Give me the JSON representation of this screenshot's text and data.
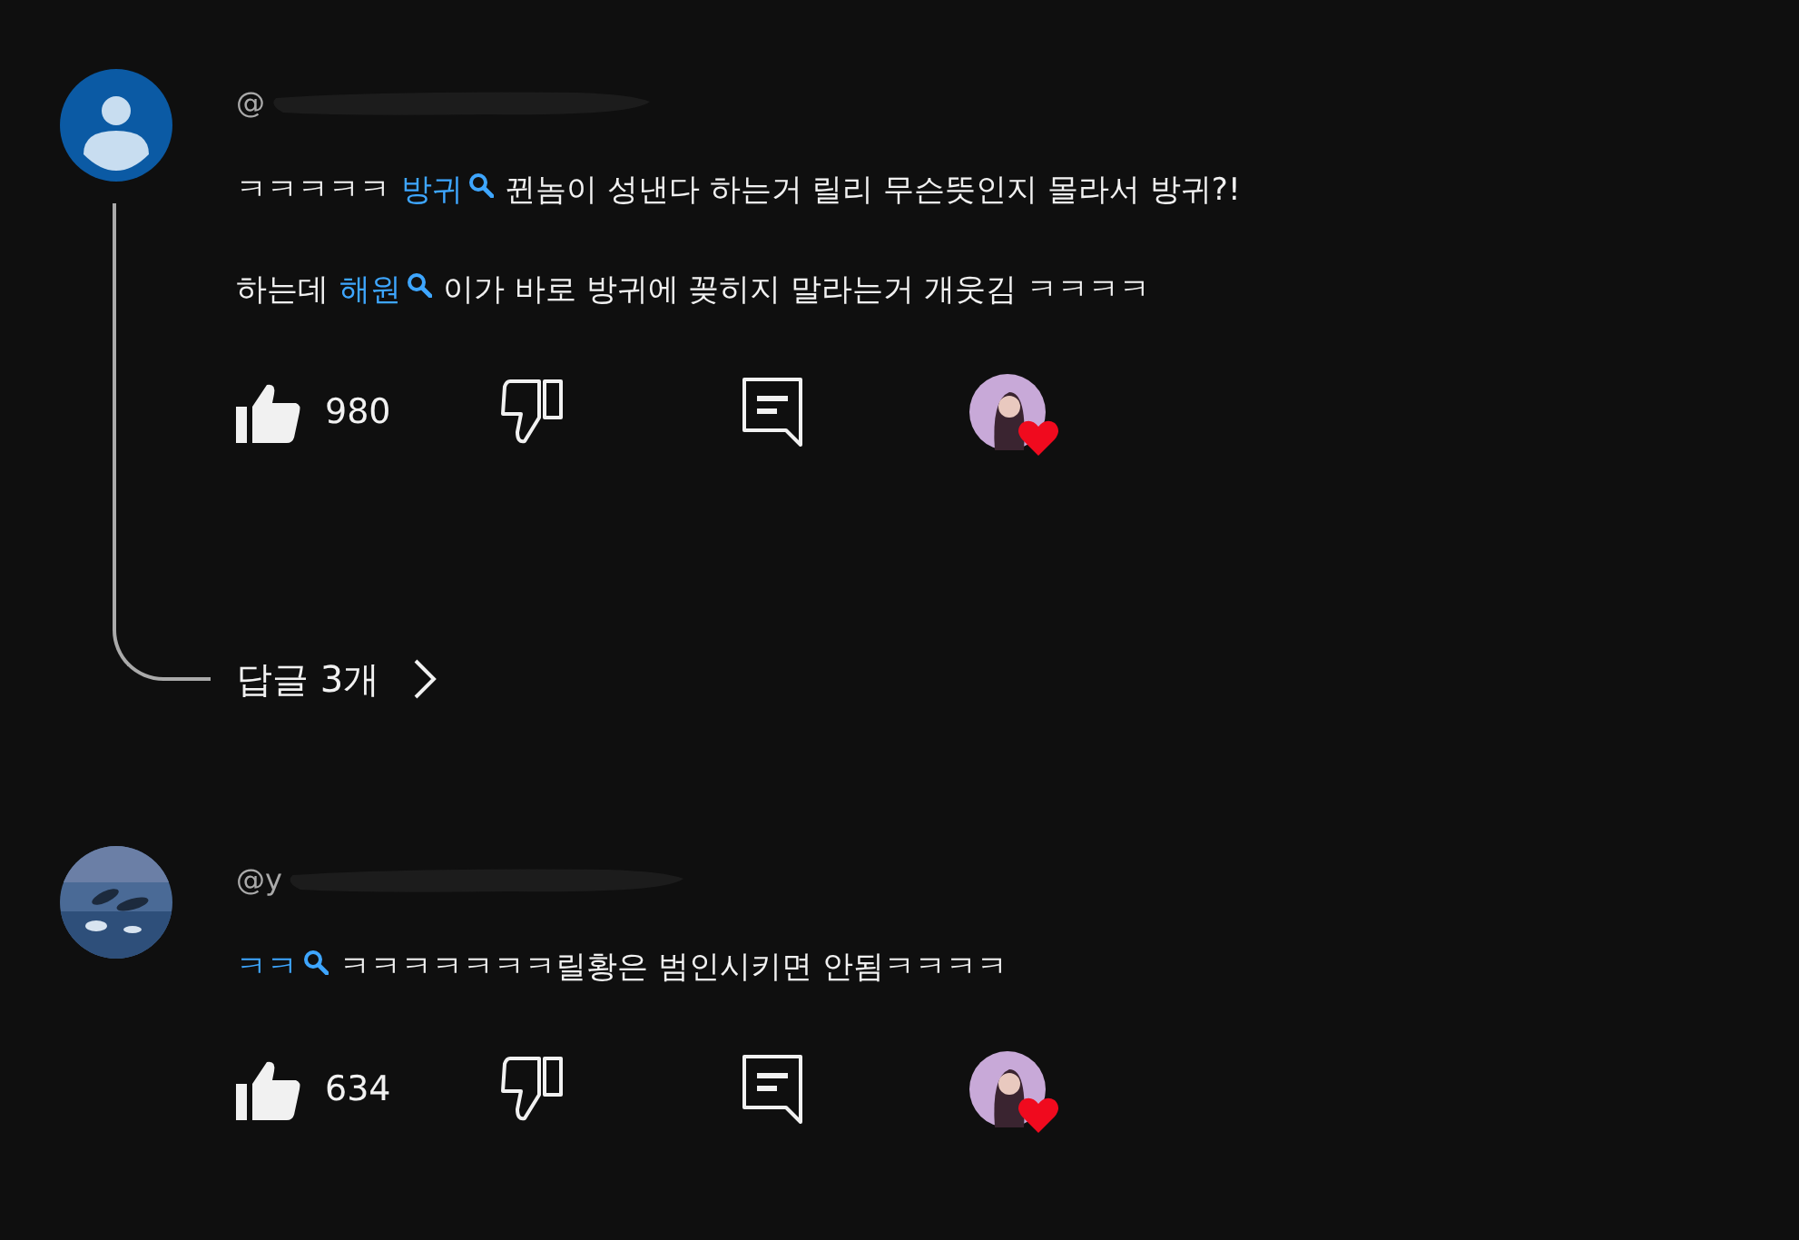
{
  "comments": [
    {
      "avatar": {
        "kind": "default"
      },
      "handle": "@",
      "lines": [
        [
          {
            "kind": "text",
            "text": "ㅋㅋㅋㅋㅋ"
          },
          {
            "kind": "link",
            "text": "방귀"
          },
          {
            "kind": "text",
            "text": "뀐놈이 성낸다 하는거 릴리 무슨뜻인지 몰라서 방귀?!"
          }
        ],
        [
          {
            "kind": "text",
            "text": "하는데"
          },
          {
            "kind": "link",
            "text": "해원"
          },
          {
            "kind": "text",
            "text": "이가 바로 방귀에 꽂히지 말라는거 개웃김 ㅋㅋㅋㅋ"
          }
        ]
      ],
      "likes": "980",
      "hearted": true,
      "replies": "답글 3개"
    },
    {
      "avatar": {
        "kind": "picture"
      },
      "handle": "@y",
      "lines": [
        [
          {
            "kind": "link",
            "text": "ㅋㅋ"
          },
          {
            "kind": "text",
            "text": "ㅋㅋㅋㅋㅋㅋㅋ릴황은 범인시키면 안됨ㅋㅋㅋㅋ"
          }
        ]
      ],
      "likes": "634",
      "hearted": true
    }
  ]
}
